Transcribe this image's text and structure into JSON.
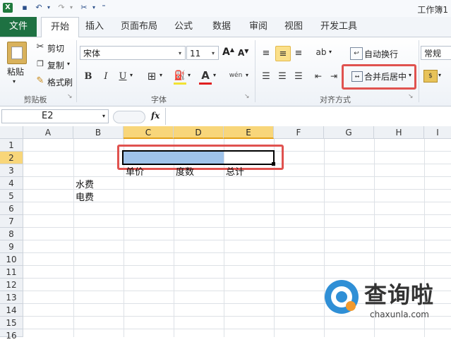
{
  "titlebar": {
    "title": "工作簿1"
  },
  "tabs": [
    "文件",
    "开始",
    "插入",
    "页面布局",
    "公式",
    "数据",
    "审阅",
    "视图",
    "开发工具"
  ],
  "clipboard": {
    "paste": "粘贴",
    "cut": "剪切",
    "copy": "复制",
    "format_painter": "格式刷",
    "group": "剪贴板"
  },
  "font": {
    "name": "宋体",
    "size": "11",
    "bold": "B",
    "italic": "I",
    "underline": "U",
    "grow": "A",
    "shrink": "A",
    "color_letter": "A",
    "phonetic": "wén",
    "group": "字体"
  },
  "alignment": {
    "wrap_text": "自动换行",
    "merge_center": "合并后居中",
    "group": "对齐方式"
  },
  "number": {
    "format": "常规"
  },
  "formula_bar": {
    "name_box": "E2",
    "fx": "fx",
    "value": ""
  },
  "columns": [
    "A",
    "B",
    "C",
    "D",
    "E",
    "F",
    "G",
    "H",
    "I"
  ],
  "rows": [
    "1",
    "2",
    "3",
    "4",
    "5",
    "6",
    "7",
    "8",
    "9",
    "10",
    "11",
    "12",
    "13",
    "14",
    "15",
    "16"
  ],
  "cells": {
    "C3": "单价",
    "D3": "度数",
    "E3": "总计",
    "B4": "水费",
    "B5": "电费"
  },
  "watermark": {
    "text": "查询啦",
    "url_text": "chaxunla.com"
  }
}
